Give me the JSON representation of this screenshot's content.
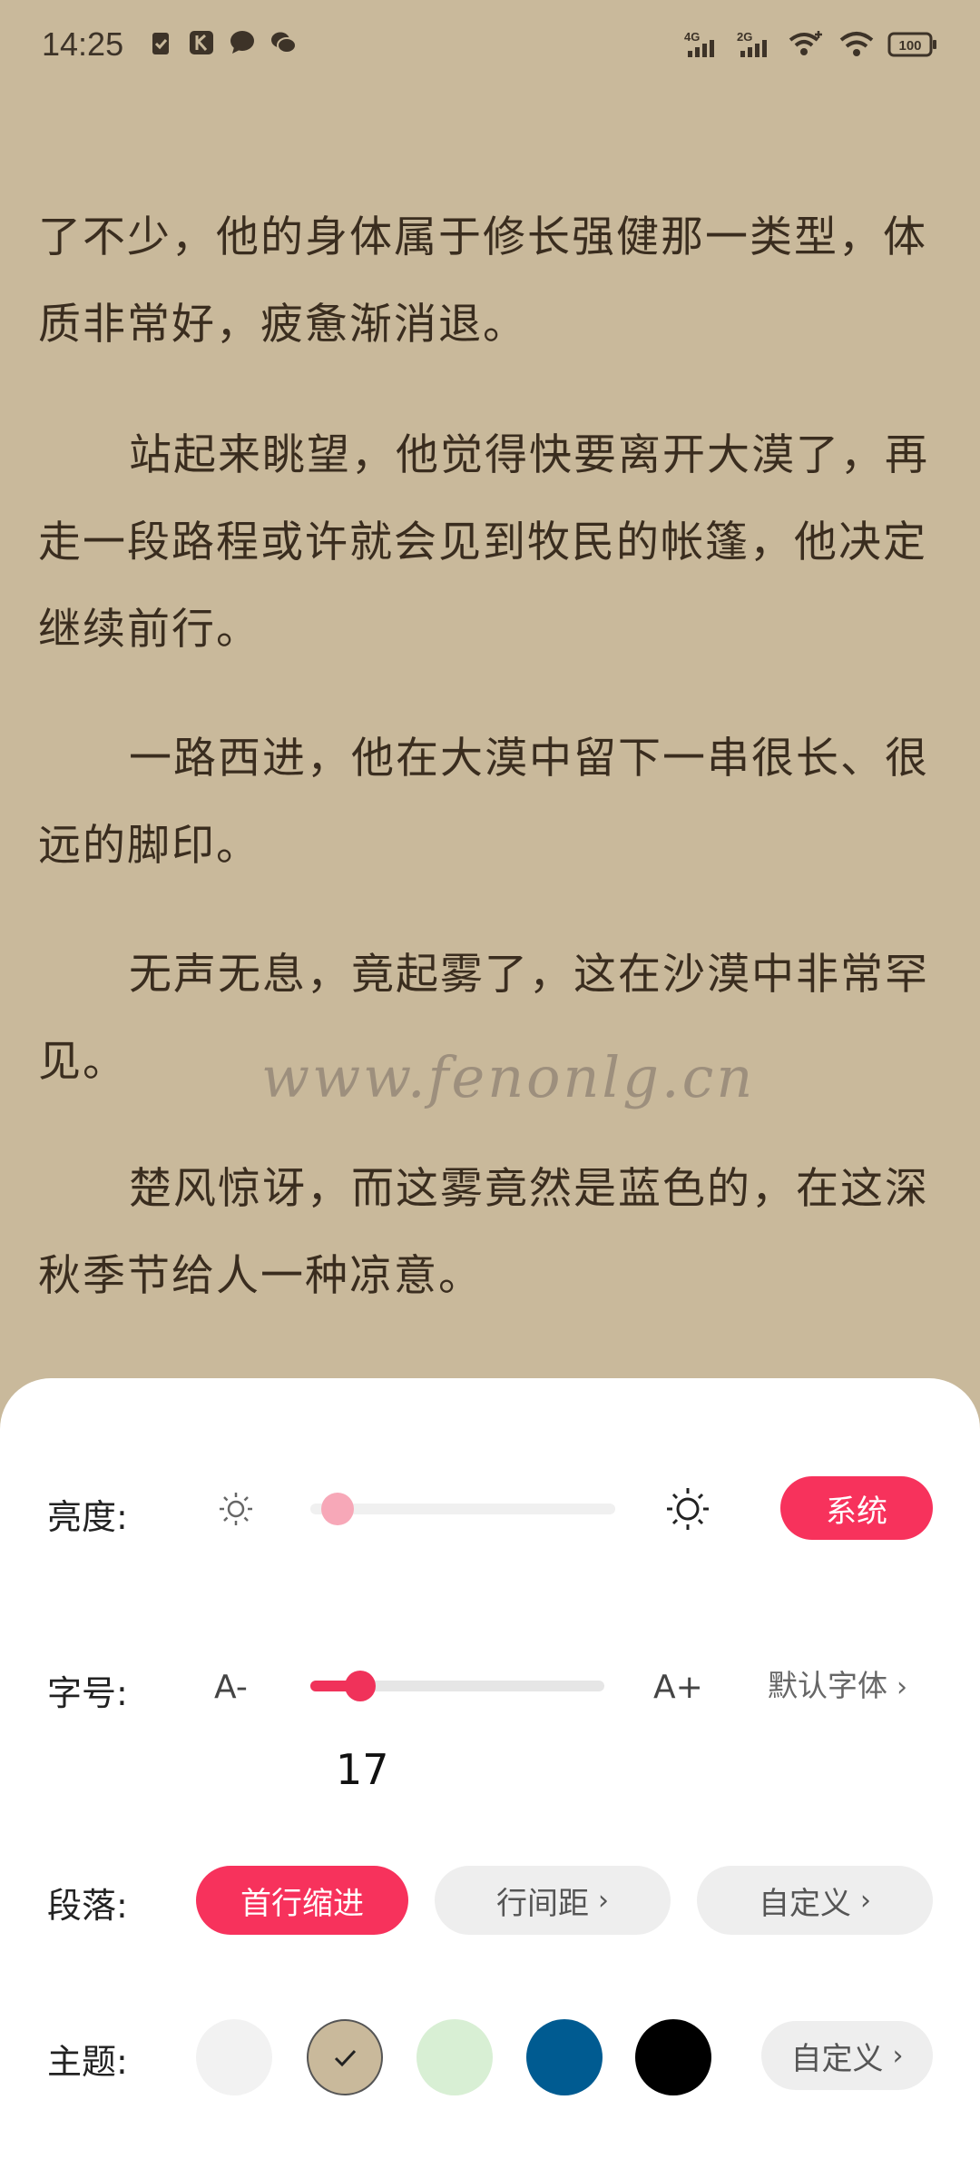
{
  "status_bar": {
    "time": "14:25",
    "left_icons": [
      "clipboard-check-icon",
      "k-app-icon",
      "chat-bubble-icon",
      "wechat-icon"
    ],
    "signal1_label": "4G",
    "signal2_label": "2G",
    "battery": "100"
  },
  "reader": {
    "paragraphs": [
      "了不少，他的身体属于修长强健那一类型，体质非常好，疲惫渐消退。",
      "站起来眺望，他觉得快要离开大漠了，再走一段路程或许就会见到牧民的帐篷，他决定继续前行。",
      "一路西进，他在大漠中留下一串很长、很远的脚印。",
      "无声无息，竟起雾了，这在沙漠中非常罕见。",
      "楚风惊讶，而这雾竟然是蓝色的，在这深秋季节给人一种凉意。"
    ],
    "watermark": "www.fenonlg.cn"
  },
  "settings": {
    "brightness": {
      "label": "亮度:",
      "level": 0.06,
      "system_button": "系统"
    },
    "font_size": {
      "label": "字号:",
      "decrease": "A-",
      "increase": "A+",
      "value": "17",
      "level": 0.17,
      "font_link": "默认字体"
    },
    "paragraph": {
      "label": "段落:",
      "first_indent": "首行缩进",
      "line_spacing": "行间距",
      "custom": "自定义"
    },
    "theme": {
      "label": "主题:",
      "swatches": [
        "#f2f2f2",
        "#c9b99b",
        "#d8efd4",
        "#005b91",
        "#000000"
      ],
      "selected_index": 1,
      "custom": "自定义"
    },
    "accent_color": "#f7325c"
  }
}
